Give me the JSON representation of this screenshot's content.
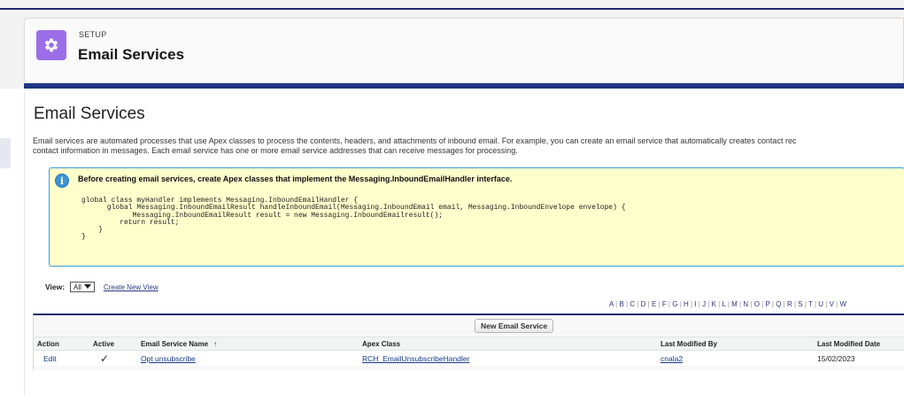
{
  "header": {
    "breadcrumb": "SETUP",
    "title": "Email Services"
  },
  "page": {
    "title": "Email Services",
    "description_line1": "Email services are automated processes that use Apex classes to process the contents, headers, and attachments of inbound email. For example, you can create an email service that automatically creates contact rec",
    "description_line2": "contact information in messages. Each email service has one or more email service addresses that can receive messages for processing."
  },
  "info": {
    "heading": "Before creating email services, create Apex classes that implement the Messaging.InboundEmailHandler interface.",
    "code": "global class myHandler implements Messaging.InboundEmailHandler {\n      global Messaging.InboundEmailResult handleInboundEmail(Messaging.InboundEmail email, Messaging.InboundEnvelope envelope) {\n            Messaging.InboundEmailResult result = new Messaging.InboundEmailresult();\n         return result;\n    }\n}"
  },
  "view": {
    "label": "View:",
    "selected": "All",
    "create_link": "Create New View"
  },
  "alphabet": [
    "A",
    "B",
    "C",
    "D",
    "E",
    "F",
    "G",
    "H",
    "I",
    "J",
    "K",
    "L",
    "M",
    "N",
    "O",
    "P",
    "Q",
    "R",
    "S",
    "T",
    "U",
    "V",
    "W"
  ],
  "list": {
    "new_button": "New Email Service",
    "columns": {
      "action": "Action",
      "active": "Active",
      "name": "Email Service Name",
      "name_sort": "↑",
      "apex": "Apex Class",
      "modified_by": "Last Modified By",
      "modified_date": "Last Modified Date"
    },
    "rows": [
      {
        "action": "Edit",
        "active": "✓",
        "name": "Opt unsubscribe",
        "apex": "RCH_EmailUnsubscribeHandler",
        "modified_by": "cnala2",
        "modified_date": "15/02/2023"
      }
    ]
  },
  "colors": {
    "accent": "#1a2a6c",
    "gear_tile": "#9b6ee8",
    "info_bg": "#ffffcc",
    "info_border": "#39a0e0",
    "link": "#15398a"
  }
}
